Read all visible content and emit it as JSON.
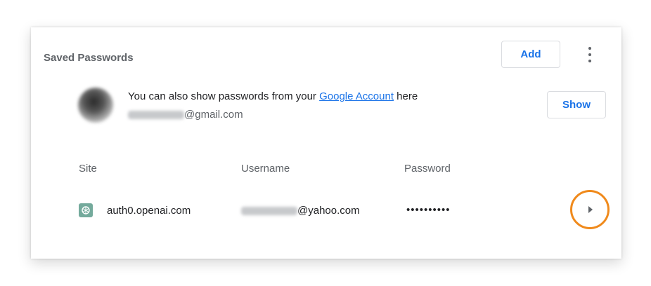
{
  "section": {
    "title": "Saved Passwords",
    "add_button": "Add",
    "menu_icon": "more-vert-icon"
  },
  "account": {
    "message_prefix": "You can also show passwords from your ",
    "link_text": "Google Account",
    "message_suffix": " here",
    "email_suffix": "@gmail.com",
    "show_button": "Show"
  },
  "table": {
    "headers": {
      "site": "Site",
      "username": "Username",
      "password": "Password"
    },
    "rows": [
      {
        "site": "auth0.openai.com",
        "site_icon": "openai-icon",
        "username_suffix": "@yahoo.com",
        "password": "••••••••••",
        "expand_icon": "arrow-right-icon"
      }
    ]
  },
  "colors": {
    "accent": "#1a73e8",
    "highlight_ring": "#f08a1c",
    "site_icon_bg": "#74aa9c"
  }
}
